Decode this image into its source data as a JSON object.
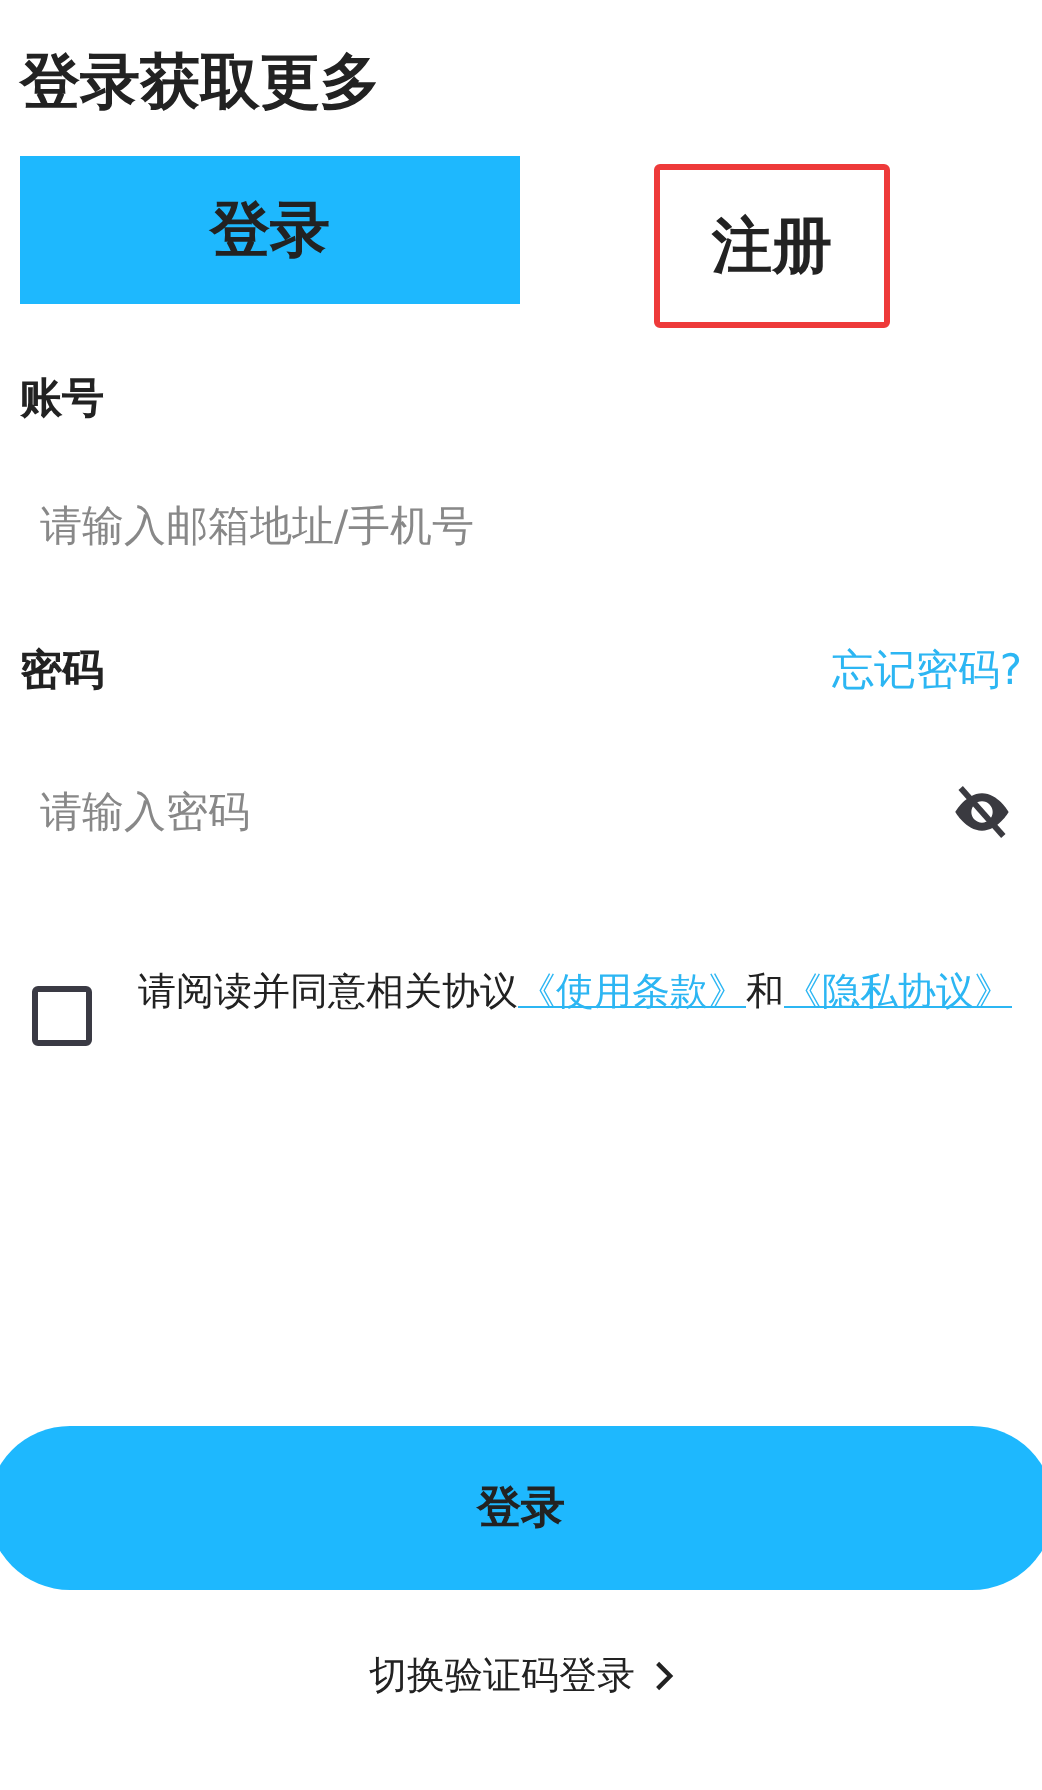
{
  "title": "登录获取更多",
  "tabs": [
    {
      "label": "登录",
      "selected": true,
      "highlighted": false
    },
    {
      "label": "注册",
      "selected": false,
      "highlighted": true
    }
  ],
  "account": {
    "label": "账号",
    "placeholder": "请输入邮箱地址/手机号"
  },
  "password": {
    "label": "密码",
    "forgot_link": "忘记密码?",
    "placeholder": "请输入密码",
    "visible": false
  },
  "agreement": {
    "checked": false,
    "text": "请阅读并同意相关协议",
    "link_1": "《使用条款》",
    "joiner": "和",
    "link_2": "《隐私协议》"
  },
  "submit_button": "登录",
  "switch_link": "切换验证码登录"
}
